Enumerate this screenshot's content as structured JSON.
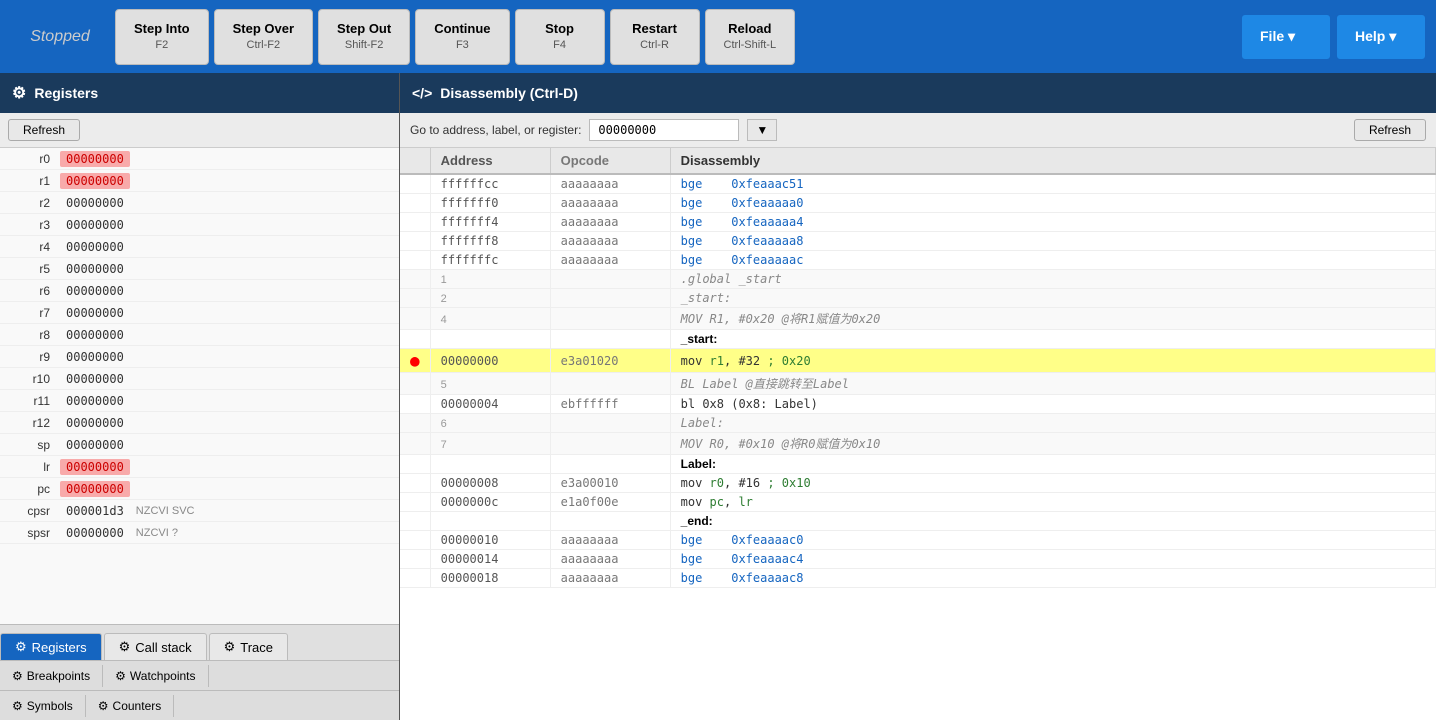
{
  "toolbar": {
    "stopped": "Stopped",
    "step_into_label": "Step Into",
    "step_into_sub": "F2",
    "step_over_label": "Step Over",
    "step_over_sub": "Ctrl-F2",
    "step_out_label": "Step Out",
    "step_out_sub": "Shift-F2",
    "continue_label": "Continue",
    "continue_sub": "F3",
    "stop_label": "Stop",
    "stop_sub": "F4",
    "restart_label": "Restart",
    "restart_sub": "Ctrl-R",
    "reload_label": "Reload",
    "reload_sub": "Ctrl-Shift-L",
    "file_label": "File ▾",
    "help_label": "Help ▾"
  },
  "registers_panel": {
    "title": "Registers",
    "refresh_label": "Refresh",
    "registers": [
      {
        "name": "r0",
        "value": "00000000",
        "highlight": true
      },
      {
        "name": "r1",
        "value": "00000000",
        "highlight": true
      },
      {
        "name": "r2",
        "value": "00000000",
        "highlight": false
      },
      {
        "name": "r3",
        "value": "00000000",
        "highlight": false
      },
      {
        "name": "r4",
        "value": "00000000",
        "highlight": false
      },
      {
        "name": "r5",
        "value": "00000000",
        "highlight": false
      },
      {
        "name": "r6",
        "value": "00000000",
        "highlight": false
      },
      {
        "name": "r7",
        "value": "00000000",
        "highlight": false
      },
      {
        "name": "r8",
        "value": "00000000",
        "highlight": false
      },
      {
        "name": "r9",
        "value": "00000000",
        "highlight": false
      },
      {
        "name": "r10",
        "value": "00000000",
        "highlight": false
      },
      {
        "name": "r11",
        "value": "00000000",
        "highlight": false
      },
      {
        "name": "r12",
        "value": "00000000",
        "highlight": false
      },
      {
        "name": "sp",
        "value": "00000000",
        "highlight": false
      },
      {
        "name": "lr",
        "value": "00000000",
        "highlight": true
      },
      {
        "name": "pc",
        "value": "00000000",
        "highlight": true
      },
      {
        "name": "cpsr",
        "value": "000001d3",
        "extra": "NZCVI SVC"
      },
      {
        "name": "spsr",
        "value": "00000000",
        "extra": "NZCVI ?"
      }
    ]
  },
  "disassembly_panel": {
    "title": "Disassembly (Ctrl-D)",
    "go_to_label": "Go to address, label, or register:",
    "addr_value": "00000000",
    "refresh_label": "Refresh",
    "col_address": "Address",
    "col_opcode": "Opcode",
    "col_disassembly": "Disassembly",
    "rows": [
      {
        "type": "code",
        "addr": "ffffffcc",
        "opcode": "aaaaaaaa",
        "disasm": "bge",
        "target": "0xfeaaac51",
        "highlight": false
      },
      {
        "type": "code",
        "addr": "fffffff0",
        "opcode": "aaaaaaaa",
        "disasm": "bge",
        "target": "0xfeaaaaa0",
        "highlight": false
      },
      {
        "type": "code",
        "addr": "fffffff4",
        "opcode": "aaaaaaaa",
        "disasm": "bge",
        "target": "0xfeaaaaa4",
        "highlight": false
      },
      {
        "type": "code",
        "addr": "fffffff8",
        "opcode": "aaaaaaaa",
        "disasm": "bge",
        "target": "0xfeaaaaa8",
        "highlight": false
      },
      {
        "type": "code",
        "addr": "fffffffc",
        "opcode": "aaaaaaaa",
        "disasm": "bge",
        "target": "0xfeaaaaac",
        "highlight": false
      },
      {
        "type": "comment",
        "linenum": "1",
        "text": ".global _start"
      },
      {
        "type": "comment",
        "linenum": "2",
        "text": "_start:"
      },
      {
        "type": "comment",
        "linenum": "4",
        "text": "MOV R1, #0x20 @将R1赋值为0x20"
      },
      {
        "type": "label",
        "text": "_start:"
      },
      {
        "type": "code",
        "addr": "00000000",
        "opcode": "e3a01020",
        "disasm": "mov     r1, #32 ; 0x20",
        "target": "",
        "highlight": true,
        "breakpoint": true
      },
      {
        "type": "comment",
        "linenum": "5",
        "text": "BL Label @直接跳转至Label"
      },
      {
        "type": "code",
        "addr": "00000004",
        "opcode": "ebffffff",
        "disasm": "bl  0x8  (0x8: Label)",
        "target": "",
        "highlight": false
      },
      {
        "type": "comment",
        "linenum": "6",
        "text": "Label:"
      },
      {
        "type": "comment",
        "linenum": "7",
        "text": "MOV R0, #0x10 @将R0赋值为0x10"
      },
      {
        "type": "label",
        "text": "Label:"
      },
      {
        "type": "code",
        "addr": "00000008",
        "opcode": "e3a00010",
        "disasm": "mov     r0, #16 ; 0x10",
        "target": "",
        "highlight": false
      },
      {
        "type": "code",
        "addr": "0000000c",
        "opcode": "e1a0f00e",
        "disasm": "mov     pc, lr",
        "target": "",
        "highlight": false
      },
      {
        "type": "label",
        "text": "_end:"
      },
      {
        "type": "code",
        "addr": "00000010",
        "opcode": "aaaaaaaa",
        "disasm": "bge",
        "target": "0xfeaaaac0",
        "highlight": false
      },
      {
        "type": "code",
        "addr": "00000014",
        "opcode": "aaaaaaaa",
        "disasm": "bge",
        "target": "0xfeaaaac4",
        "highlight": false
      },
      {
        "type": "code",
        "addr": "00000018",
        "opcode": "aaaaaaaa",
        "disasm": "bge",
        "target": "0xfeaaaac8",
        "highlight": false
      }
    ]
  },
  "bottom_tabs": {
    "tabs1": [
      {
        "label": "Registers",
        "icon": "⚙",
        "active": true
      },
      {
        "label": "Call stack",
        "icon": "⚙",
        "active": false
      },
      {
        "label": "Trace",
        "icon": "⚙",
        "active": false
      }
    ],
    "tabs2": [
      {
        "label": "Breakpoints",
        "icon": "⚙"
      },
      {
        "label": "Watchpoints",
        "icon": "⚙"
      }
    ],
    "tabs3": [
      {
        "label": "Symbols",
        "icon": "⚙"
      },
      {
        "label": "Counters",
        "icon": "⚙"
      }
    ]
  }
}
